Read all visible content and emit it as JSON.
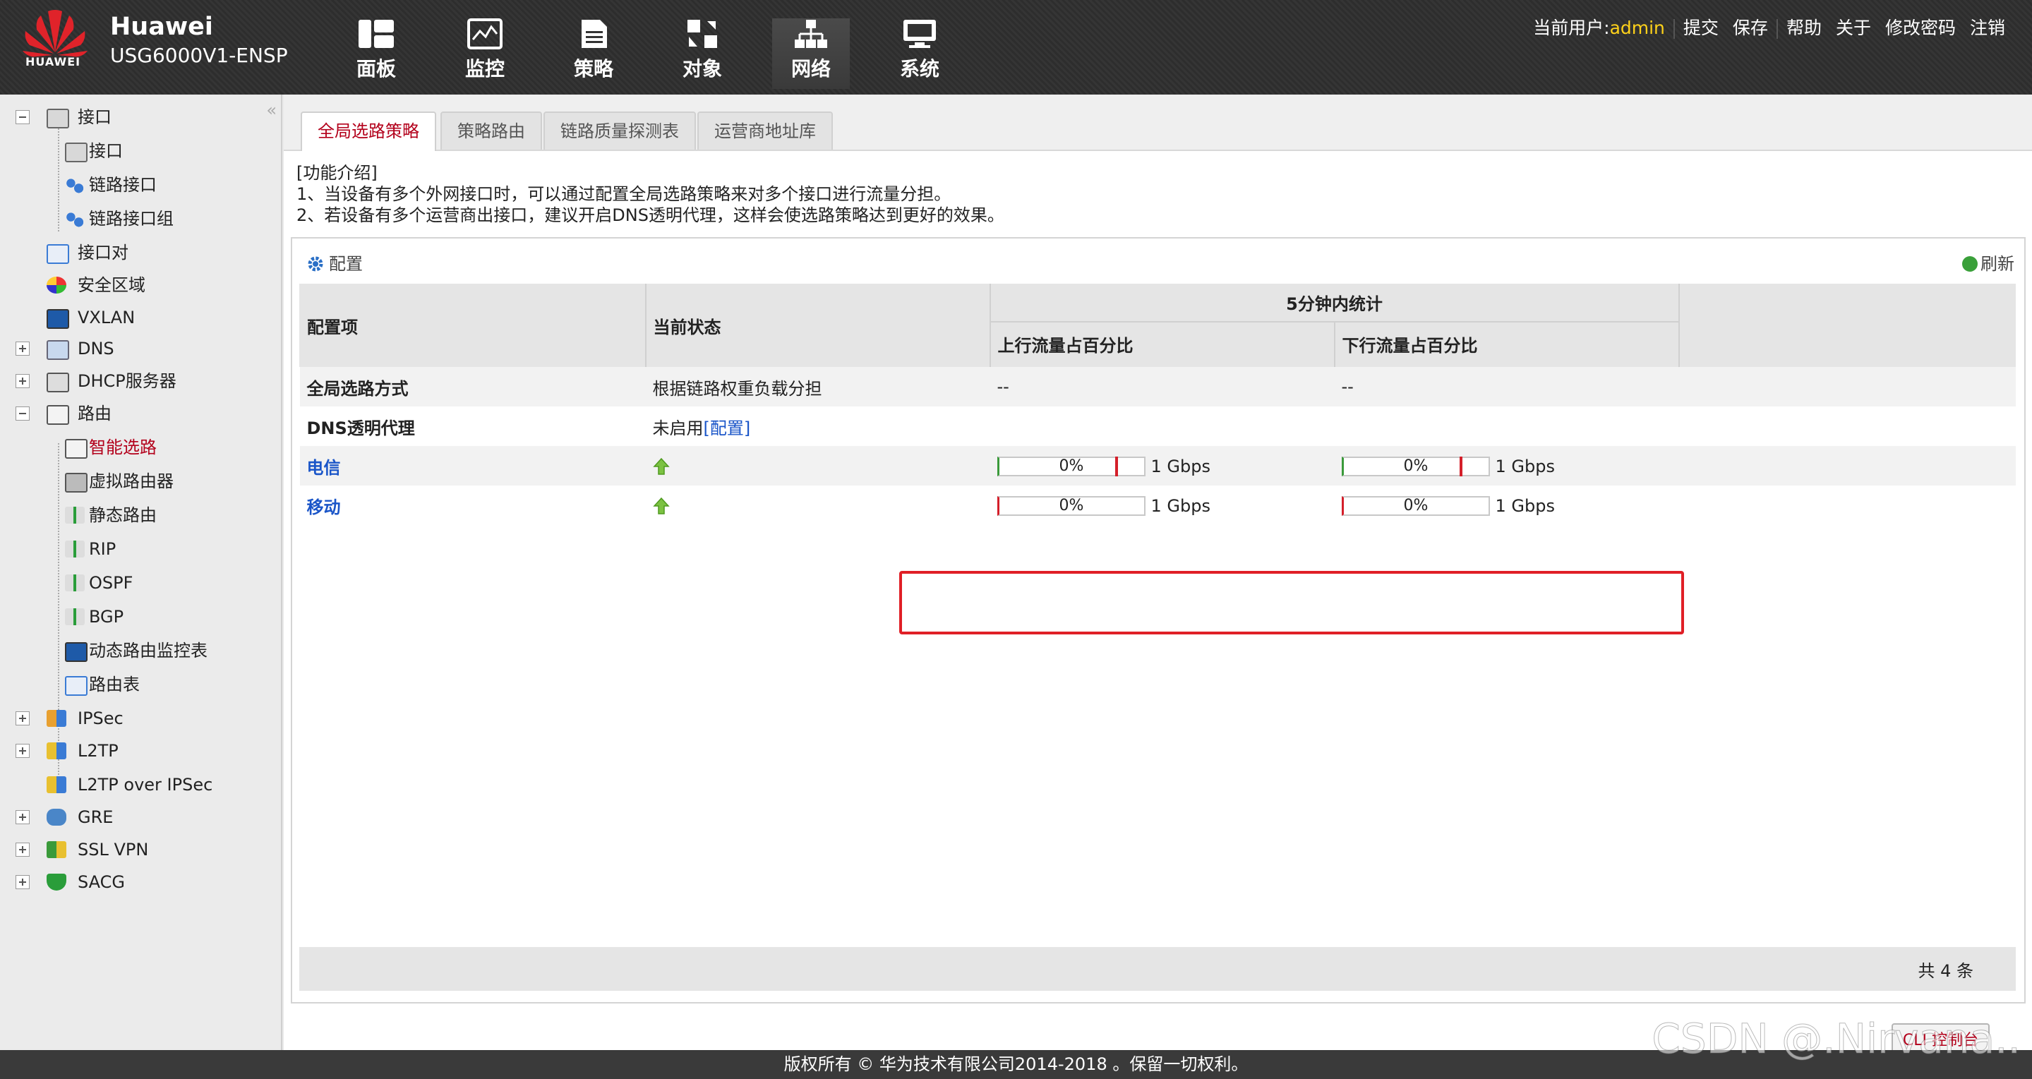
{
  "header": {
    "logo_text": "HUAWEI",
    "brand": "Huawei",
    "model": "USG6000V1-ENSP",
    "nav": [
      {
        "label": "面板",
        "icon": "dashboard-icon"
      },
      {
        "label": "监控",
        "icon": "monitor-icon"
      },
      {
        "label": "策略",
        "icon": "policy-icon"
      },
      {
        "label": "对象",
        "icon": "object-icon"
      },
      {
        "label": "网络",
        "icon": "network-icon",
        "active": true
      },
      {
        "label": "系统",
        "icon": "system-icon"
      }
    ],
    "user_label": "当前用户:",
    "user_name": "admin",
    "actions": [
      "提交",
      "保存",
      "帮助",
      "关于",
      "修改密码",
      "注销"
    ]
  },
  "sidebar": {
    "items": [
      {
        "label": "接口",
        "expander": "minus"
      },
      {
        "label": "接口"
      },
      {
        "label": "链路接口"
      },
      {
        "label": "链路接口组"
      },
      {
        "label": "接口对"
      },
      {
        "label": "安全区域"
      },
      {
        "label": "VXLAN"
      },
      {
        "label": "DNS",
        "expander": "plus"
      },
      {
        "label": "DHCP服务器",
        "expander": "plus"
      },
      {
        "label": "路由",
        "expander": "minus"
      },
      {
        "label": "智能选路",
        "selected": true
      },
      {
        "label": "虚拟路由器"
      },
      {
        "label": "静态路由"
      },
      {
        "label": "RIP"
      },
      {
        "label": "OSPF"
      },
      {
        "label": "BGP"
      },
      {
        "label": "动态路由监控表"
      },
      {
        "label": "路由表"
      },
      {
        "label": "IPSec",
        "expander": "plus"
      },
      {
        "label": "L2TP",
        "expander": "plus"
      },
      {
        "label": "L2TP over IPSec"
      },
      {
        "label": "GRE",
        "expander": "plus"
      },
      {
        "label": "SSL VPN",
        "expander": "plus"
      },
      {
        "label": "SACG",
        "expander": "plus"
      }
    ]
  },
  "tabs": [
    {
      "label": "全局选路策略",
      "active": true
    },
    {
      "label": "策略路由"
    },
    {
      "label": "链路质量探测表"
    },
    {
      "label": "运营商地址库"
    }
  ],
  "intro": {
    "title": "[功能介绍]",
    "line1": "1、当设备有多个外网接口时，可以通过配置全局选路策略来对多个接口进行流量分担。",
    "line2": "2、若设备有多个运营商出接口，建议开启DNS透明代理，这样会使选路策略达到更好的效果。"
  },
  "panel": {
    "title": "配置",
    "refresh": "刷新",
    "headers": {
      "item": "配置项",
      "status": "当前状态",
      "group": "5分钟内统计",
      "up": "上行流量占百分比",
      "down": "下行流量占百分比"
    },
    "rows": {
      "global_mode": {
        "item": "全局选路方式",
        "status": "根据链路权重负载分担",
        "up": "--",
        "down": "--"
      },
      "dns_proxy": {
        "item": "DNS透明代理",
        "status": "未启用",
        "status_link": "[配置]"
      },
      "telecom": {
        "item": "电信",
        "up_pct": "0%",
        "up_cap": "1 Gbps",
        "down_pct": "0%",
        "down_cap": "1 Gbps",
        "up_fraction": 0,
        "down_fraction": 0
      },
      "mobile": {
        "item": "移动",
        "up_pct": "0%",
        "up_cap": "1 Gbps",
        "down_pct": "0%",
        "down_cap": "1 Gbps",
        "up_fraction": 0,
        "down_fraction": 0
      }
    },
    "count": "共 4 条"
  },
  "cli_button": "CLI 控制台",
  "copyright": "版权所有 © 华为技术有限公司2014-2018 。保留一切权利。",
  "watermark": "CSDN @.Nirvana..",
  "colors": {
    "accent": "#b3001b",
    "link": "#1a55c8",
    "highlight": "#e01f26",
    "ok": "#7ccf62",
    "user": "#ffd21a"
  }
}
